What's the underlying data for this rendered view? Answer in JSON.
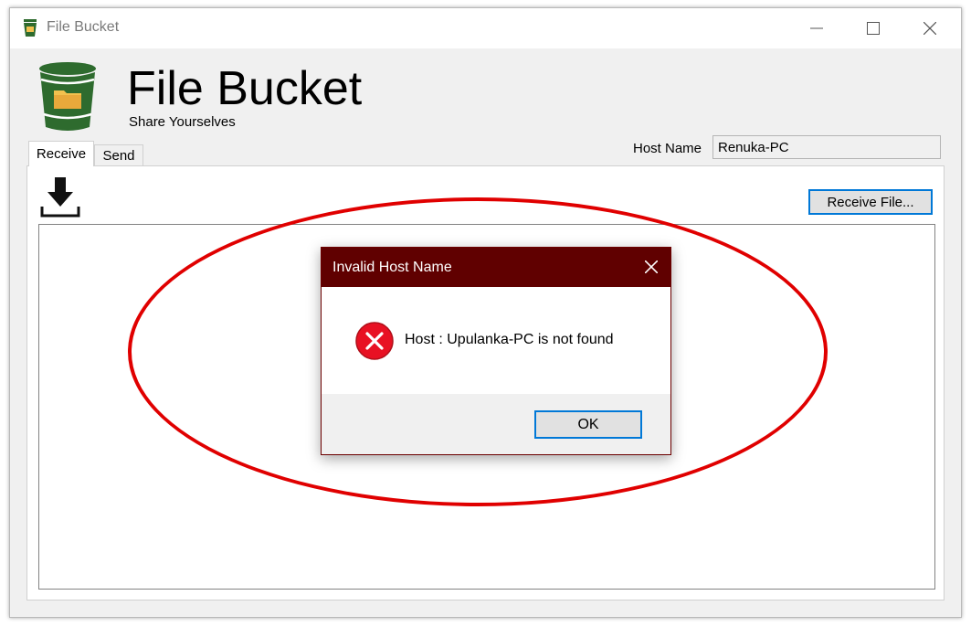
{
  "window": {
    "title": "File Bucket",
    "controls": {
      "minimize": "minimize-icon",
      "maximize": "maximize-icon",
      "close": "close-icon"
    }
  },
  "header": {
    "app_title": "File Bucket",
    "subtitle": "Share Yourselves",
    "logo_icon": "bucket-folder-icon",
    "logo_color": "#2e6b2e"
  },
  "host": {
    "label": "Host Name",
    "value": "Renuka-PC"
  },
  "tabs": [
    {
      "label": "Receive",
      "selected": true
    },
    {
      "label": "Send",
      "selected": false
    }
  ],
  "receive_panel": {
    "download_icon": "download-icon",
    "receive_button_label": "Receive File..."
  },
  "dialog": {
    "title": "Invalid Host Name",
    "message": "Host : Upulanka-PC is not found",
    "error_icon": "error-icon",
    "ok_label": "OK",
    "titlebar_color": "#600000",
    "error_color": "#e81123"
  },
  "annotation": {
    "shape": "ellipse",
    "color": "#e00000"
  }
}
